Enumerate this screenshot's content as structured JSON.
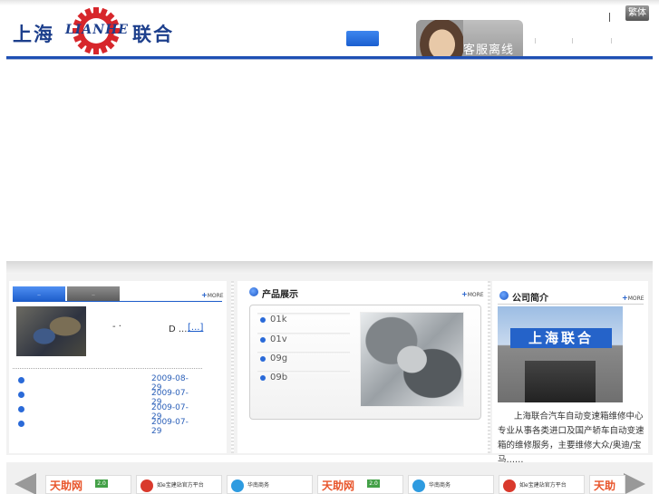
{
  "header": {
    "logo_left": "上海",
    "logo_brand": "LIANHE",
    "logo_right": "联合",
    "service_label": "客服离线",
    "lang_button": "繁体"
  },
  "news_panel": {
    "more_label": "MORE",
    "headline_fragment": "- ·",
    "headline_tail": "D ...",
    "more_link": "[...]",
    "items": [
      {
        "date": "2009-08-29"
      },
      {
        "date": "2009-07-29"
      },
      {
        "date": "2009-07-29"
      },
      {
        "date": "2009-07-29"
      }
    ]
  },
  "products_panel": {
    "title": "产品展示",
    "more_label": "MORE",
    "items": [
      {
        "label": "01k"
      },
      {
        "label": "01v"
      },
      {
        "label": "09g"
      },
      {
        "label": "09b"
      }
    ]
  },
  "about_panel": {
    "title": "公司简介",
    "more_label": "MORE",
    "sign_text": "上海联合",
    "description": "上海联合汽车自动变速箱维修中心专业从事各类进口及国产轿车自动变速箱的维修服务，主要维修大众/奥迪/宝马……"
  },
  "partners": [
    {
      "name": "天助网",
      "badge": "2.0",
      "color": "#e8542a"
    },
    {
      "name": "",
      "text": "如e宝建站官方平台",
      "color": "#d9392c"
    },
    {
      "name": "",
      "text": "华南商务",
      "color": "#2e9be0"
    },
    {
      "name": "天助网",
      "badge": "2.0",
      "color": "#e8542a"
    },
    {
      "name": "",
      "text": "华南商务",
      "color": "#2e9be0"
    },
    {
      "name": "",
      "text": "如e宝建站官方平台",
      "color": "#d9392c"
    },
    {
      "name": "天助",
      "badge": "",
      "color": "#e8542a"
    }
  ],
  "colors": {
    "brand_blue": "#1e4fb4",
    "accent_blue": "#2a6ad8"
  }
}
